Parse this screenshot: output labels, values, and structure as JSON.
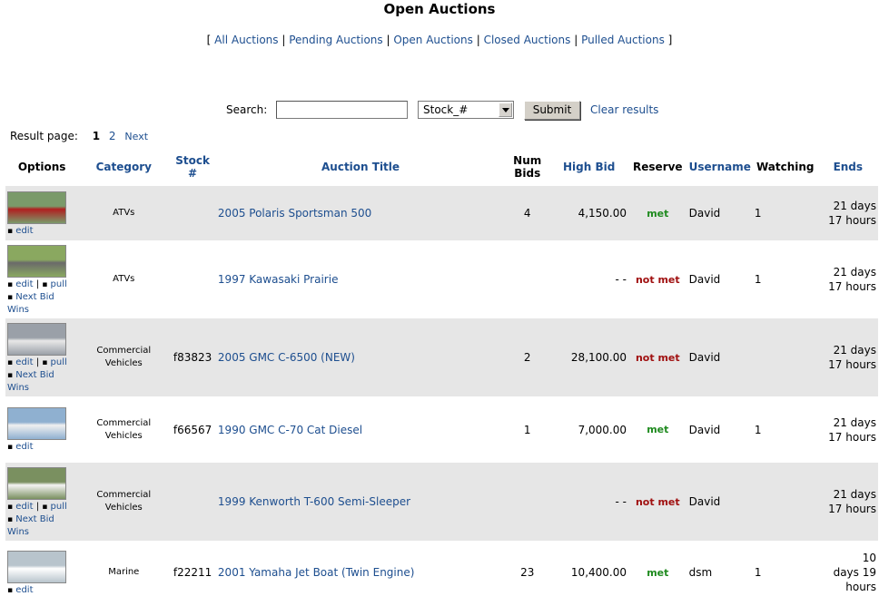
{
  "page": {
    "title": "Open Auctions"
  },
  "status_nav": {
    "open_bracket": "[",
    "close_bracket": "]",
    "separator": "|",
    "links": [
      "All Auctions",
      "Pending Auctions",
      "Open Auctions",
      "Closed Auctions",
      "Pulled Auctions"
    ]
  },
  "search": {
    "label": "Search:",
    "input_value": "",
    "field_selected": "Stock_#",
    "submit_label": "Submit",
    "clear_label": "Clear results"
  },
  "pagination": {
    "label": "Result page:",
    "current": "1",
    "other_page": "2",
    "next_label": "Next"
  },
  "table": {
    "headers": {
      "options": "Options",
      "category": "Category",
      "stock": "Stock #",
      "title": "Auction Title",
      "num_bids_1": "Num",
      "num_bids_2": "Bids",
      "high_bid": "High Bid",
      "reserve": "Reserve",
      "username": "Username",
      "watching": "Watching",
      "ends": "Ends"
    },
    "option_labels": {
      "edit": "edit",
      "pull": "pull",
      "next_bid_wins": "Next Bid Wins",
      "bullet": "▪",
      "sep": "|"
    },
    "rows": [
      {
        "thumb_icon": "atv-red-photo",
        "thumb_colors": [
          "#7a9a6a",
          "#b02020"
        ],
        "category_1": "ATVs",
        "category_2": "",
        "stock": "",
        "title": "2005 Polaris Sportsman 500",
        "bids": "4",
        "high_bid": "4,150.00",
        "reserve": "met",
        "username": "David",
        "watching": "1",
        "ends_1": "21 days",
        "ends_2": "17 hours",
        "ends_3": ""
      },
      {
        "thumb_icon": "atv-gray-photo",
        "thumb_colors": [
          "#8aa860",
          "#6a6a6a"
        ],
        "category_1": "ATVs",
        "category_2": "",
        "stock": "",
        "title": "1997 Kawasaki Prairie",
        "bids": "",
        "high_bid": "- -",
        "reserve": "not met",
        "username": "David",
        "watching": "1",
        "ends_1": "21 days",
        "ends_2": "17 hours",
        "ends_3": ""
      },
      {
        "thumb_icon": "dump-truck-photo",
        "thumb_colors": [
          "#9aa0a8",
          "#e8e8e8"
        ],
        "category_1": "Commercial",
        "category_2": "Vehicles",
        "stock": "f83823",
        "title": "2005 GMC C-6500 (NEW)",
        "bids": "2",
        "high_bid": "28,100.00",
        "reserve": "not met",
        "username": "David",
        "watching": "",
        "ends_1": "21 days",
        "ends_2": "17 hours",
        "ends_3": ""
      },
      {
        "thumb_icon": "dump-truck-photo",
        "thumb_colors": [
          "#8fb0d0",
          "#f0f0f0"
        ],
        "category_1": "Commercial",
        "category_2": "Vehicles",
        "stock": "f66567",
        "title": "1990 GMC C-70 Cat Diesel",
        "bids": "1",
        "high_bid": "7,000.00",
        "reserve": "met",
        "username": "David",
        "watching": "1",
        "ends_1": "21 days",
        "ends_2": "17 hours",
        "ends_3": ""
      },
      {
        "thumb_icon": "semi-truck-photo",
        "thumb_colors": [
          "#7a9060",
          "#f4f4f4"
        ],
        "category_1": "Commercial",
        "category_2": "Vehicles",
        "stock": "",
        "title": "1999 Kenworth T-600 Semi-Sleeper",
        "bids": "",
        "high_bid": "- -",
        "reserve": "not met",
        "username": "David",
        "watching": "",
        "ends_1": "21 days",
        "ends_2": "17 hours",
        "ends_3": ""
      },
      {
        "thumb_icon": "boat-photo",
        "thumb_colors": [
          "#b8c4cc",
          "#ffffff"
        ],
        "category_1": "Marine",
        "category_2": "",
        "stock": "f22211",
        "title": "2001 Yamaha Jet Boat (Twin Engine)",
        "bids": "23",
        "high_bid": "10,400.00",
        "reserve": "met",
        "username": "dsm",
        "watching": "1",
        "ends_1": "10",
        "ends_2": "days 19",
        "ends_3": "hours"
      }
    ]
  }
}
